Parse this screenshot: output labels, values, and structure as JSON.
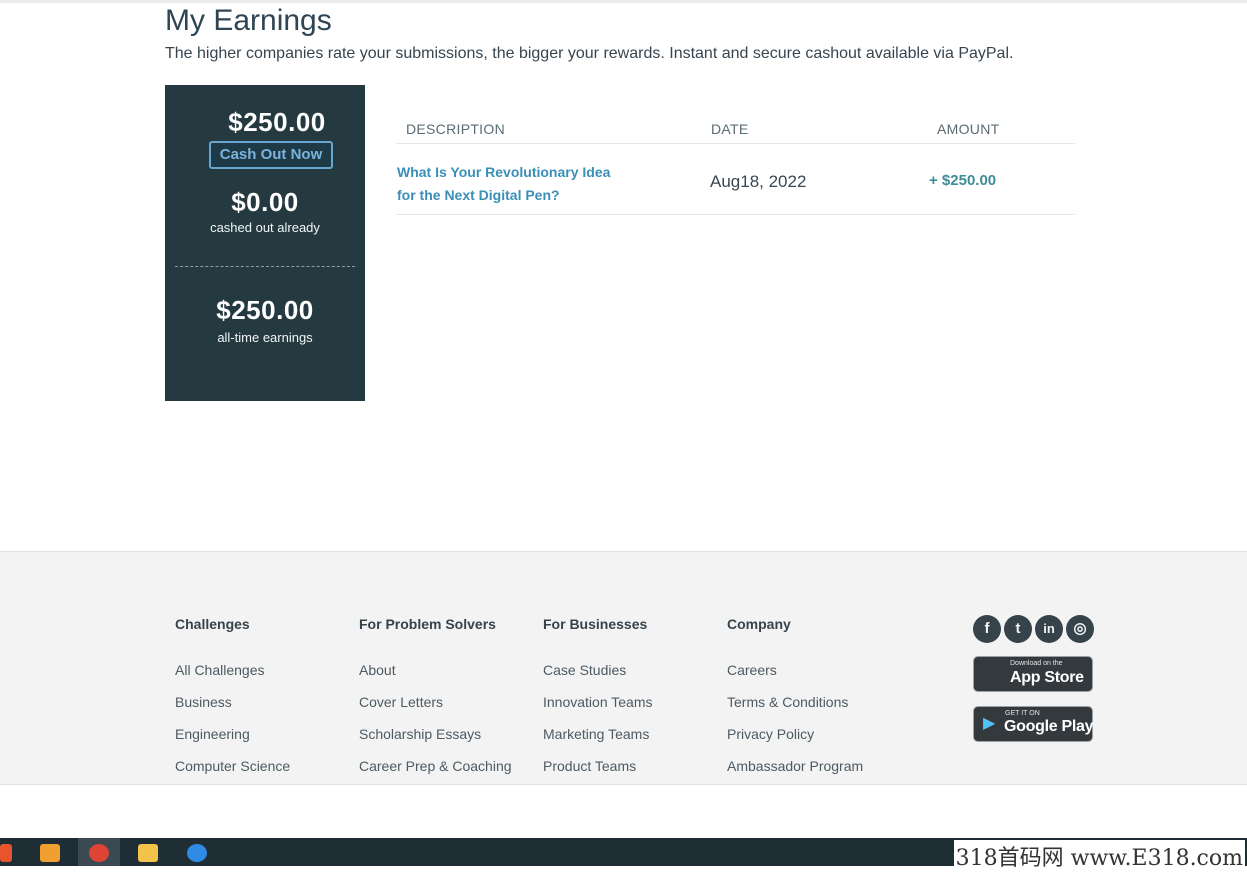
{
  "header": {
    "title": "My Earnings",
    "subtitle": "The higher companies rate your submissions, the bigger your rewards. Instant and secure cashout available via PayPal."
  },
  "summary": {
    "current_balance": "$250.00",
    "cash_out_label": "Cash Out Now",
    "cashed_out_amount": "$0.00",
    "cashed_out_label": "cashed out already",
    "all_time_amount": "$250.00",
    "all_time_label": "all-time earnings"
  },
  "table": {
    "columns": [
      "DESCRIPTION",
      "DATE",
      "AMOUNT"
    ],
    "rows": [
      {
        "description": "What Is Your Revolutionary Idea for the Next Digital Pen?",
        "date": "Aug18, 2022",
        "amount": "+ $250.00"
      }
    ]
  },
  "footer": {
    "columns": [
      {
        "heading": "Challenges",
        "links": [
          "All Challenges",
          "Business",
          "Engineering",
          "Computer Science"
        ]
      },
      {
        "heading": "For Problem Solvers",
        "links": [
          "About",
          "Cover Letters",
          "Scholarship Essays",
          "Career Prep & Coaching"
        ]
      },
      {
        "heading": "For Businesses",
        "links": [
          "Case Studies",
          "Innovation Teams",
          "Marketing Teams",
          "Product Teams"
        ]
      },
      {
        "heading": "Company",
        "links": [
          "Careers",
          "Terms & Conditions",
          "Privacy Policy",
          "Ambassador Program"
        ]
      }
    ],
    "social": [
      {
        "icon": "facebook-icon",
        "glyph": "f"
      },
      {
        "icon": "twitter-icon",
        "glyph": "t"
      },
      {
        "icon": "linkedin-icon",
        "glyph": "in"
      },
      {
        "icon": "instagram-icon",
        "glyph": "◎"
      }
    ],
    "app_store": {
      "small": "Download on the",
      "big": "App Store",
      "glyph": ""
    },
    "google_play": {
      "small": "GET IT ON",
      "big": "Google Play",
      "glyph": "▶"
    }
  },
  "watermark": "318首码网 www.E318.com",
  "colors": {
    "summary_bg": "#253a40",
    "link": "#3a8fb7",
    "amount": "#3e8c96",
    "footer_bg": "#f3f3f3"
  }
}
